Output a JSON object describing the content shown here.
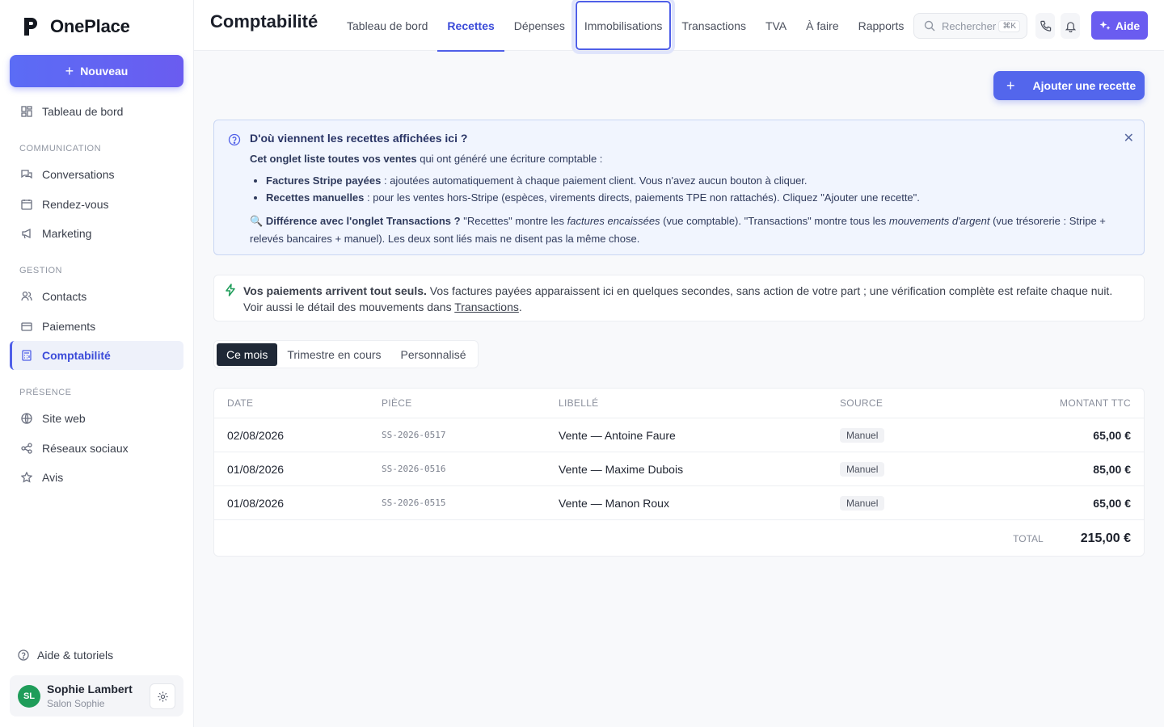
{
  "app": {
    "name": "OnePlace"
  },
  "sidebar": {
    "new_label": "Nouveau",
    "dashboard": "Tableau de bord",
    "sections": {
      "communication": "COMMUNICATION",
      "gestion": "GESTION",
      "presence": "PRÉSENCE"
    },
    "items": {
      "conversations": "Conversations",
      "rendez_vous": "Rendez-vous",
      "marketing": "Marketing",
      "contacts": "Contacts",
      "paiements": "Paiements",
      "comptabilite": "Comptabilité",
      "site_web": "Site web",
      "reseaux": "Réseaux sociaux",
      "avis": "Avis"
    },
    "help": "Aide & tutoriels",
    "user": {
      "initials": "SL",
      "name": "Sophie Lambert",
      "business": "Salon Sophie"
    }
  },
  "header": {
    "title": "Comptabilité",
    "tabs": [
      "Tableau de bord",
      "Recettes",
      "Dépenses",
      "Immobilisations",
      "Transactions",
      "TVA",
      "À faire",
      "Rapports"
    ],
    "active_tab": "Recettes",
    "focused_tab": "Immobilisations",
    "search_placeholder": "Rechercher",
    "search_shortcut": "⌘K",
    "help_label": "Aide"
  },
  "actions": {
    "add_recette": "Ajouter une recette"
  },
  "info": {
    "title": "D'où viennent les recettes affichées ici ?",
    "intro_bold": "Cet onglet liste toutes vos ventes",
    "intro_rest": " qui ont généré une écriture comptable :",
    "bullet1_bold": "Factures Stripe payées",
    "bullet1_rest": " : ajoutées automatiquement à chaque paiement client. Vous n'avez aucun bouton à cliquer.",
    "bullet2_bold": "Recettes manuelles",
    "bullet2_rest": " : pour les ventes hors-Stripe (espèces, virements directs, paiements TPE non rattachés). Cliquez \"Ajouter une recette\".",
    "diff_emoji": "🔍",
    "diff_bold": "Différence avec l'onglet Transactions ?",
    "diff_part1": " \"Recettes\" montre les ",
    "diff_italic1": "factures encaissées",
    "diff_part2": " (vue comptable). \"Transactions\" montre tous les ",
    "diff_italic2": "mouvements d'argent",
    "diff_part3": " (vue trésorerie : Stripe + relevés bancaires + manuel). Les deux sont liés mais ne disent pas la même chose."
  },
  "notice": {
    "bold": "Vos paiements arrivent tout seuls.",
    "text": " Vos factures payées apparaissent ici en quelques secondes, sans action de votre part ; une vérification complète est refaite chaque nuit. Voir aussi le détail des mouvements dans ",
    "link": "Transactions",
    "end": "."
  },
  "period": {
    "options": [
      "Ce mois",
      "Trimestre en cours",
      "Personnalisé"
    ],
    "active": "Ce mois"
  },
  "table": {
    "headers": {
      "date": "DATE",
      "piece": "PIÈCE",
      "label": "LIBELLÉ",
      "source": "SOURCE",
      "amount": "MONTANT TTC"
    },
    "rows": [
      {
        "date": "02/08/2026",
        "piece": "SS-2026-0517",
        "label": "Vente — Antoine Faure",
        "source": "Manuel",
        "amount": "65,00 €"
      },
      {
        "date": "01/08/2026",
        "piece": "SS-2026-0516",
        "label": "Vente — Maxime Dubois",
        "source": "Manuel",
        "amount": "85,00 €"
      },
      {
        "date": "01/08/2026",
        "piece": "SS-2026-0515",
        "label": "Vente — Manon Roux",
        "source": "Manuel",
        "amount": "65,00 €"
      }
    ],
    "total_label": "TOTAL",
    "total_value": "215,00 €"
  },
  "colors": {
    "accent": "#4f5fe8",
    "aide": "#6a5cf0",
    "success": "#1f9d5a",
    "dark": "#1f2836"
  }
}
